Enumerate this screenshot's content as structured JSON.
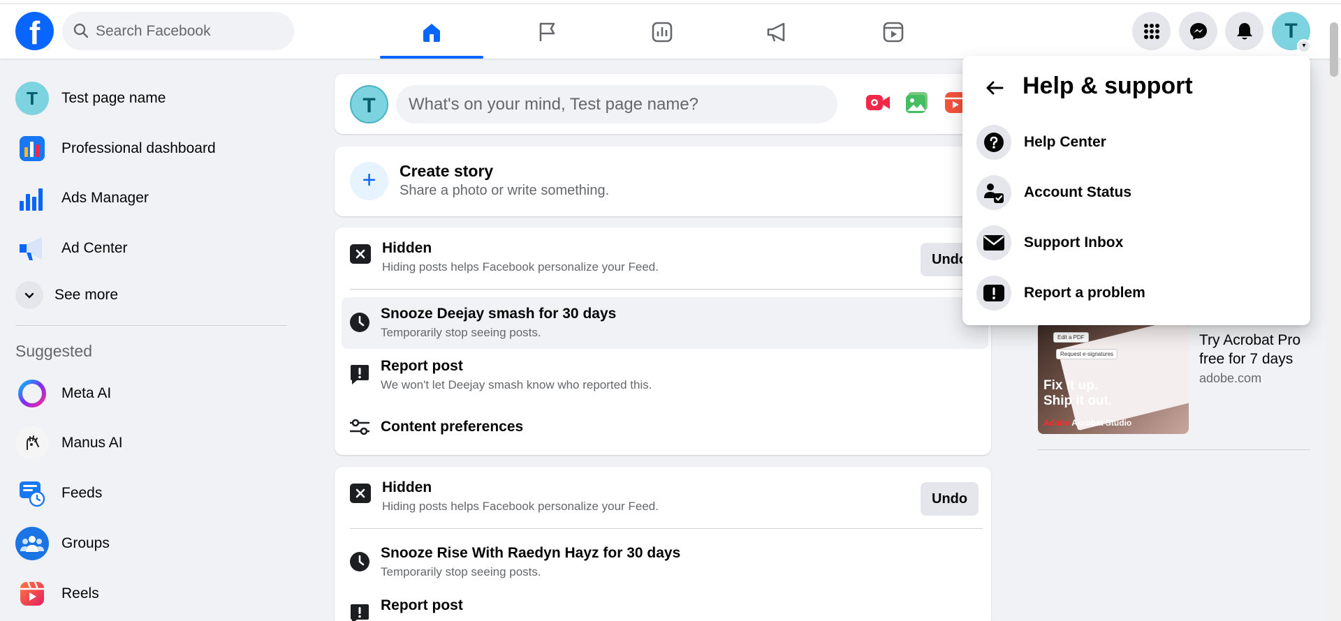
{
  "header": {
    "search_placeholder": "Search Facebook",
    "logo_letter": "f",
    "user_initial": "T"
  },
  "colors": {
    "brand": "#0866ff",
    "avatar_bg": "#7dd3e0",
    "background": "#f0f2f5"
  },
  "sidebar": {
    "items": [
      {
        "label": "Test page name",
        "icon": "avatar-icon",
        "initial": "T"
      },
      {
        "label": "Professional dashboard",
        "icon": "dashboard-icon"
      },
      {
        "label": "Ads Manager",
        "icon": "bar-chart-icon"
      },
      {
        "label": "Ad Center",
        "icon": "megaphone-icon"
      }
    ],
    "see_more": "See more",
    "suggested_heading": "Suggested",
    "suggested": [
      {
        "label": "Meta AI",
        "icon": "meta-ai-icon"
      },
      {
        "label": "Manus AI",
        "icon": "manus-ai-icon"
      },
      {
        "label": "Feeds",
        "icon": "feeds-icon"
      },
      {
        "label": "Groups",
        "icon": "groups-icon"
      },
      {
        "label": "Reels",
        "icon": "reels-icon"
      }
    ]
  },
  "composer": {
    "initial": "T",
    "placeholder": "What's on your mind, Test page name?"
  },
  "story": {
    "title": "Create story",
    "subtitle": "Share a photo or write something."
  },
  "hidden_posts": [
    {
      "title": "Hidden",
      "subtitle": "Hiding posts helps Facebook personalize your Feed.",
      "undo": "Undo",
      "snooze_title": "Snooze Deejay smash for 30 days",
      "snooze_sub": "Temporarily stop seeing posts.",
      "report_title": "Report post",
      "report_sub": "We won't let Deejay smash know who reported this.",
      "prefs": "Content preferences"
    },
    {
      "title": "Hidden",
      "subtitle": "Hiding posts helps Facebook personalize your Feed.",
      "undo": "Undo",
      "snooze_title": "Snooze Rise With Raedyn Hayz for 30 days",
      "snooze_sub": "Temporarily stop seeing posts.",
      "report_title": "Report post"
    }
  ],
  "ad": {
    "image_chip_1": "Edit a PDF",
    "image_chip_2": "Request e-signatures",
    "image_tagline_1": "Fix it up.",
    "image_tagline_2": "Ship it out.",
    "image_brand_red": "Adobe",
    "image_brand": " Acrobat Studio",
    "title": "Try Acrobat Pro free for 7 days",
    "domain": "adobe.com"
  },
  "help_menu": {
    "title": "Help & support",
    "items": [
      {
        "label": "Help Center",
        "icon": "question-icon"
      },
      {
        "label": "Account Status",
        "icon": "account-status-icon"
      },
      {
        "label": "Support Inbox",
        "icon": "envelope-icon"
      },
      {
        "label": "Report a problem",
        "icon": "alert-icon"
      }
    ]
  }
}
